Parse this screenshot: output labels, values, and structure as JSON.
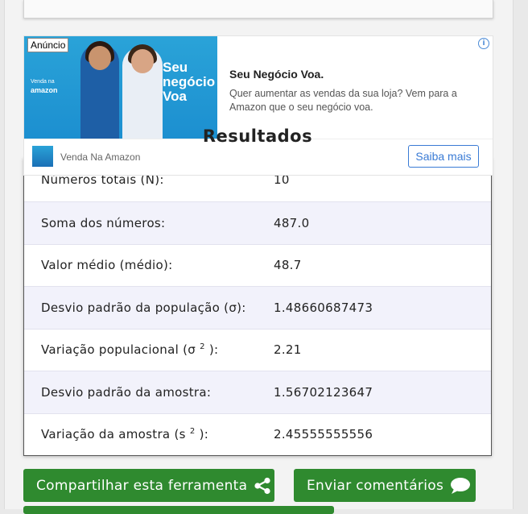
{
  "ad": {
    "badge": "Anúncio",
    "info_glyph": "i",
    "image_small_text": "Venda na",
    "image_brand": "amazon",
    "image_slogan": "Seu negócio Voa",
    "headline": "Seu Negócio Voa.",
    "description": "Quer aumentar as vendas da sua loja? Vem para a Amazon que o seu negócio voa.",
    "sponsor": "Venda Na Amazon",
    "cta": "Saiba mais"
  },
  "results": {
    "title": "Resultados",
    "rows": [
      {
        "label": "Números totais (N):",
        "value": "10"
      },
      {
        "label": "Soma dos números:",
        "value": "487.0"
      },
      {
        "label": "Valor médio (médio):",
        "value": "48.7"
      },
      {
        "label": "Desvio padrão da população (σ):",
        "value": "1.48660687473"
      },
      {
        "label_pre": "Variação populacional (σ ",
        "label_sup": "2",
        "label_post": " ):",
        "value": "2.21"
      },
      {
        "label": "Desvio padrão da amostra:",
        "value": "1.56702123647"
      },
      {
        "label_pre": "Variação da amostra (s ",
        "label_sup": "2",
        "label_post": " ):",
        "value": "2.45555555556"
      }
    ]
  },
  "buttons": {
    "share": "Compartilhar esta ferramenta",
    "share_icon": "share-icon",
    "feedback": "Enviar comentários",
    "feedback_icon": "comment-icon"
  },
  "colors": {
    "button_green": "#2f8a2f",
    "alt_row": "#f2f2fb",
    "ad_accent": "#3a7bd5"
  }
}
